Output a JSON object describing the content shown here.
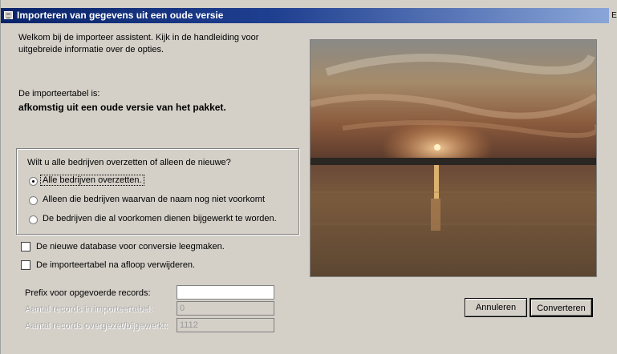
{
  "window": {
    "title": "Importeren van gegevens uit een oude versie",
    "icon": "window-icon",
    "edge_glyph": "E"
  },
  "intro": {
    "line1": "Welkom bij de importeer assistent. Kijk in de handleiding voor",
    "line2": "uitgebreide informatie over de opties."
  },
  "source": {
    "label": "De importeertabel is:",
    "value": "afkomstig uit een oude versie van het pakket."
  },
  "options_group": {
    "question": "Wilt u alle bedrijven overzetten of alleen de nieuwe?",
    "radios": [
      {
        "label": "Alle bedrijven overzetten.",
        "selected": true
      },
      {
        "label": "Alleen die bedrijven waarvan de naam nog niet voorkomt",
        "selected": false
      },
      {
        "label": "De bedrijven die al voorkomen dienen bijgewerkt te worden.",
        "selected": false
      }
    ]
  },
  "checkboxes": [
    {
      "label": "De nieuwe database voor conversie leegmaken.",
      "checked": false
    },
    {
      "label": "De importeertabel na afloop verwijderen.",
      "checked": false
    }
  ],
  "fields": {
    "prefix_label": "Prefix voor opgevoerde records:",
    "prefix_value": "",
    "field2_label": "Aantal records in importeertabel:",
    "field2_value": "0",
    "field3_label": "Aantal records overgezet/bijgewerkt:",
    "field3_value": "1112"
  },
  "buttons": {
    "cancel": "Annuleren",
    "convert": "Converteren"
  },
  "colors": {
    "titlebar_start": "#0a246a",
    "titlebar_end": "#8aa6d8",
    "dialog_face": "#d4d0c8"
  }
}
